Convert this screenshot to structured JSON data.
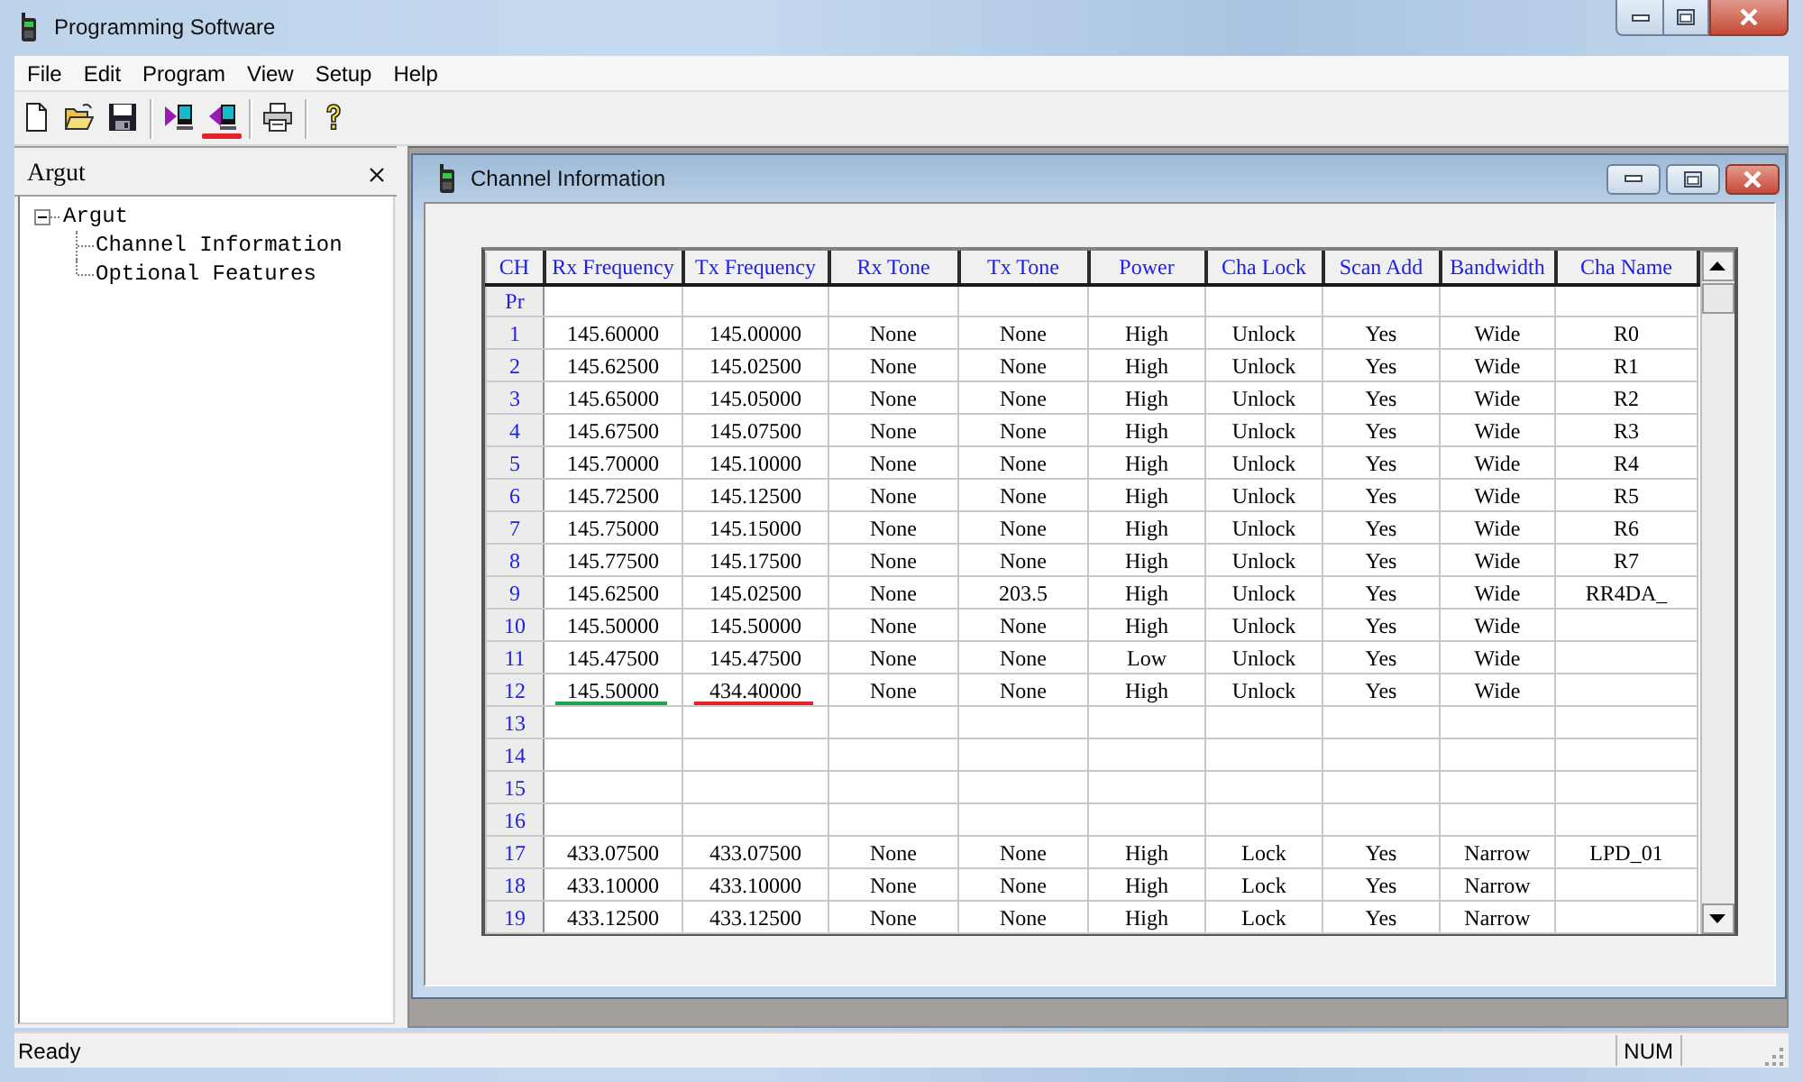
{
  "window": {
    "title": "Programming Software"
  },
  "menu": [
    "File",
    "Edit",
    "Program",
    "View",
    "Setup",
    "Help"
  ],
  "toolbar": [
    {
      "kind": "new"
    },
    {
      "kind": "open"
    },
    {
      "kind": "save"
    },
    {
      "kind": "separator"
    },
    {
      "kind": "read"
    },
    {
      "kind": "write",
      "underlined": true,
      "color": "#e3232b"
    },
    {
      "kind": "separator"
    },
    {
      "kind": "print"
    },
    {
      "kind": "separator"
    },
    {
      "kind": "help"
    }
  ],
  "side_panel": {
    "title": "Argut",
    "tree": [
      {
        "label": "Argut",
        "expanded": true,
        "children": [
          {
            "label": "Channel Information"
          },
          {
            "label": "Optional Features"
          }
        ]
      }
    ]
  },
  "child_window": {
    "title": "Channel Information",
    "table": {
      "columns": [
        "CH",
        "Rx Frequency",
        "Tx Frequency",
        "Rx Tone",
        "Tx Tone",
        "Power",
        "Cha Lock",
        "Scan Add",
        "Bandwidth",
        "Cha Name"
      ],
      "sub_header": "Pr",
      "rows": [
        {
          "ch": "1",
          "cells": [
            "145.60000",
            "145.00000",
            "None",
            "None",
            "High",
            "Unlock",
            "Yes",
            "Wide",
            "R0"
          ]
        },
        {
          "ch": "2",
          "cells": [
            "145.62500",
            "145.02500",
            "None",
            "None",
            "High",
            "Unlock",
            "Yes",
            "Wide",
            "R1"
          ]
        },
        {
          "ch": "3",
          "cells": [
            "145.65000",
            "145.05000",
            "None",
            "None",
            "High",
            "Unlock",
            "Yes",
            "Wide",
            "R2"
          ]
        },
        {
          "ch": "4",
          "cells": [
            "145.67500",
            "145.07500",
            "None",
            "None",
            "High",
            "Unlock",
            "Yes",
            "Wide",
            "R3"
          ]
        },
        {
          "ch": "5",
          "cells": [
            "145.70000",
            "145.10000",
            "None",
            "None",
            "High",
            "Unlock",
            "Yes",
            "Wide",
            "R4"
          ]
        },
        {
          "ch": "6",
          "cells": [
            "145.72500",
            "145.12500",
            "None",
            "None",
            "High",
            "Unlock",
            "Yes",
            "Wide",
            "R5"
          ]
        },
        {
          "ch": "7",
          "cells": [
            "145.75000",
            "145.15000",
            "None",
            "None",
            "High",
            "Unlock",
            "Yes",
            "Wide",
            "R6"
          ]
        },
        {
          "ch": "8",
          "cells": [
            "145.77500",
            "145.17500",
            "None",
            "None",
            "High",
            "Unlock",
            "Yes",
            "Wide",
            "R7"
          ]
        },
        {
          "ch": "9",
          "cells": [
            "145.62500",
            "145.02500",
            "None",
            "203.5",
            "High",
            "Unlock",
            "Yes",
            "Wide",
            "RR4DA_"
          ]
        },
        {
          "ch": "10",
          "cells": [
            "145.50000",
            "145.50000",
            "None",
            "None",
            "High",
            "Unlock",
            "Yes",
            "Wide"
          ]
        },
        {
          "ch": "11",
          "cells": [
            "145.47500",
            "145.47500",
            "None",
            "None",
            "Low",
            "Unlock",
            "Yes",
            "Wide"
          ]
        },
        {
          "ch": "12",
          "cells": [
            {
              "text": "145.50000",
              "underlined": true,
              "color": "#1fa34a"
            },
            {
              "text": "434.40000",
              "underlined": true,
              "color": "#e3232b"
            },
            "None",
            "None",
            "High",
            "Unlock",
            "Yes",
            "Wide"
          ]
        },
        {
          "ch": "13"
        },
        {
          "ch": "14"
        },
        {
          "ch": "15"
        },
        {
          "ch": "16"
        },
        {
          "ch": "17",
          "cells": [
            "433.07500",
            "433.07500",
            "None",
            "None",
            "High",
            "Lock",
            "Yes",
            "Narrow",
            "LPD_01"
          ]
        },
        {
          "ch": "18",
          "cells": [
            "433.10000",
            "433.10000",
            "None",
            "None",
            "High",
            "Lock",
            "Yes",
            "Narrow"
          ]
        },
        {
          "ch": "19",
          "cells": [
            "433.12500",
            "433.12500",
            "None",
            "None",
            "High",
            "Lock",
            "Yes",
            "Narrow"
          ]
        }
      ]
    }
  },
  "status_bar": {
    "message": "Ready",
    "indicators": [
      "NUM"
    ]
  }
}
